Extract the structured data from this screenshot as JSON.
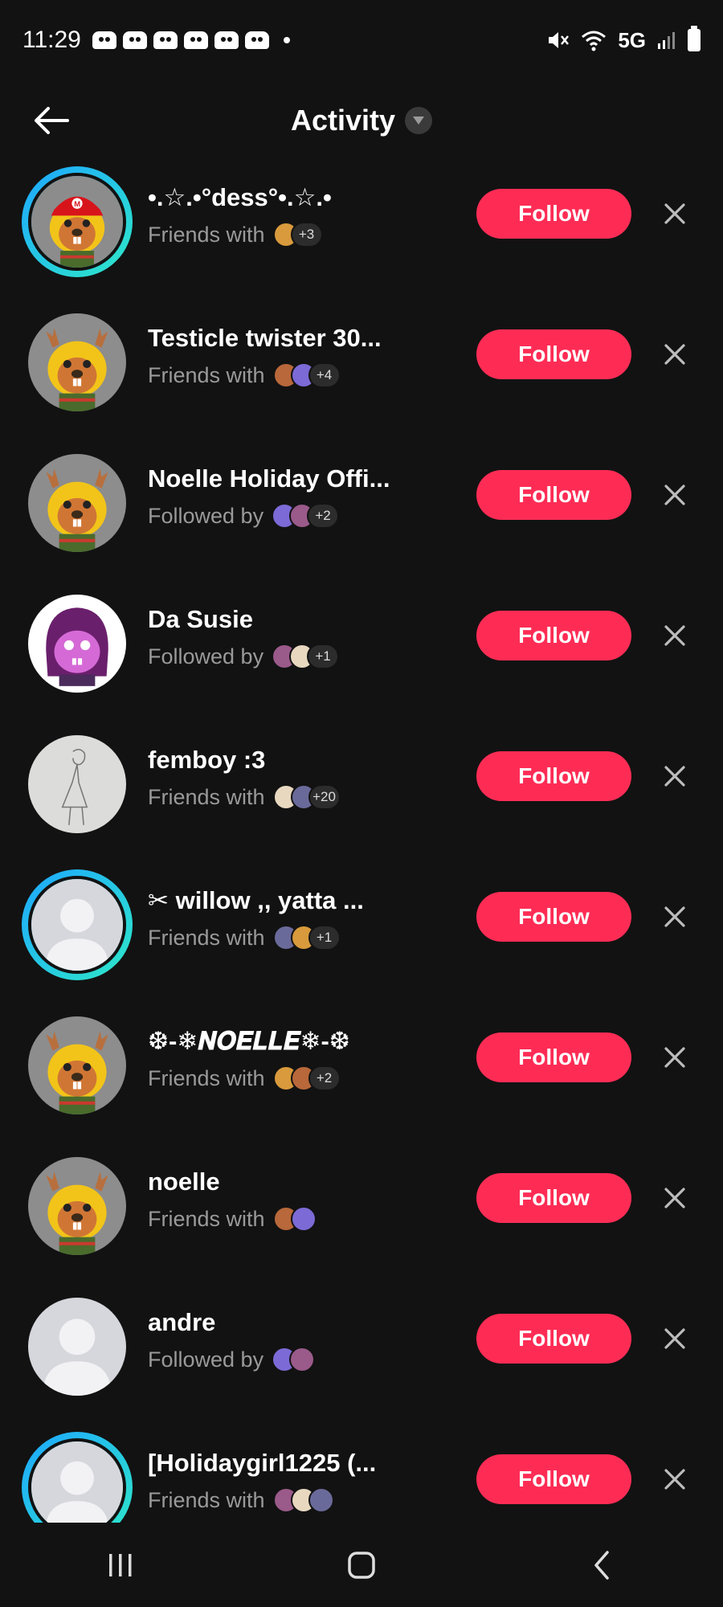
{
  "status_bar": {
    "time": "11:29",
    "network": "5G",
    "icons": [
      "discord-icon",
      "discord-icon",
      "discord-icon",
      "discord-icon",
      "discord-icon",
      "discord-icon",
      "notification-dot",
      "mute-icon",
      "wifi-icon",
      "signal-icon",
      "battery-icon"
    ]
  },
  "header": {
    "title": "Activity",
    "back_icon": "arrow-left-icon",
    "dropdown_icon": "triangle-down-icon"
  },
  "colors": {
    "background": "#121212",
    "follow_button": "#fe2c55",
    "ring_gradient": [
      "#1ea7ff",
      "#2ee8c8"
    ],
    "secondary_text": "#9a9a9a"
  },
  "rows": [
    {
      "name": "•.☆.•°dess°•.☆.•",
      "relation": "Friends with",
      "extra": "+3",
      "avatar": "mario-hat-beaver",
      "ring": true,
      "minis": 1
    },
    {
      "name": "Testicle twister 30...",
      "relation": "Friends with",
      "extra": "+4",
      "avatar": "reindeer-beaver",
      "ring": false,
      "minis": 2
    },
    {
      "name": "Noelle Holiday Offi...",
      "relation": "Followed by",
      "extra": "+2",
      "avatar": "reindeer-beaver",
      "ring": false,
      "minis": 2
    },
    {
      "name": "Da Susie",
      "relation": "Followed by",
      "extra": "+1",
      "avatar": "purple-susie",
      "ring": false,
      "minis": 2
    },
    {
      "name": "femboy :3",
      "relation": "Friends with",
      "extra": "+20",
      "avatar": "pencil-sketch",
      "ring": false,
      "minis": 2
    },
    {
      "name": "✂ willow ,, yatta ...",
      "relation": "Friends with",
      "extra": "+1",
      "avatar": "default",
      "ring": true,
      "minis": 2
    },
    {
      "name": "❆-❄𝑵𝑶𝑬𝑳𝑳𝑬❄-❆",
      "relation": "Friends with",
      "extra": "+2",
      "avatar": "reindeer-beaver",
      "ring": false,
      "minis": 2
    },
    {
      "name": "noelle",
      "relation": "Friends with",
      "extra": "",
      "avatar": "reindeer-beaver",
      "ring": false,
      "minis": 2
    },
    {
      "name": "andre",
      "relation": "Followed by",
      "extra": "",
      "avatar": "default",
      "ring": false,
      "minis": 2
    },
    {
      "name": "[Holidaygirl1225 (...",
      "relation": "Friends with",
      "extra": "",
      "avatar": "default",
      "ring": true,
      "minis": 3
    }
  ],
  "follow_label": "Follow",
  "dismiss_icon": "close-x-icon",
  "nav": {
    "recents_icon": "recents-icon",
    "home_icon": "home-icon",
    "back_icon": "nav-back-icon"
  }
}
